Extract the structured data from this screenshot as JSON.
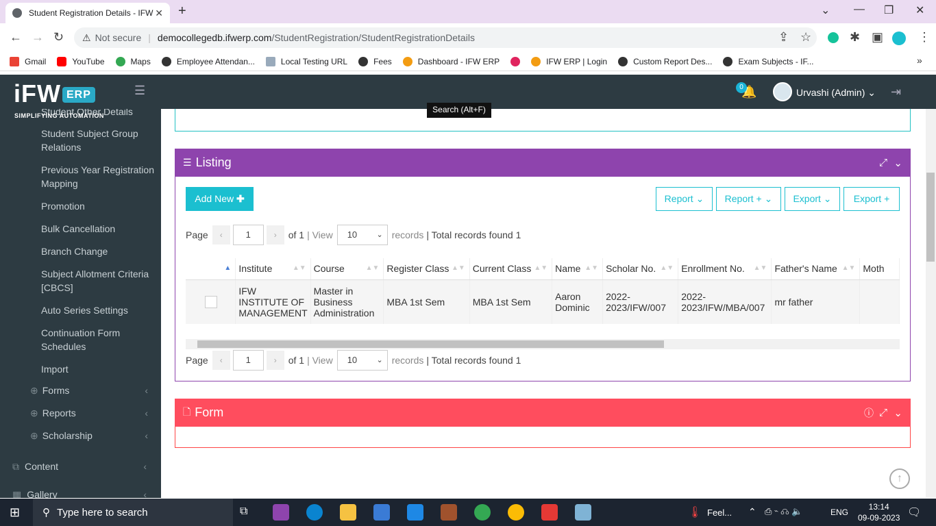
{
  "browser": {
    "tab_title": "Student Registration Details - IFW",
    "not_secure": "Not secure",
    "url_host": "democollegedb.ifwerp.com",
    "url_path": "/StudentRegistration/StudentRegistrationDetails",
    "bookmarks": [
      "Gmail",
      "YouTube",
      "Maps",
      "Employee Attendan...",
      "Local Testing URL",
      "Fees",
      "Dashboard - IFW ERP",
      "IFW ERP | Login",
      "Custom Report Des...",
      "Exam Subjects - IF..."
    ]
  },
  "header": {
    "logo_text": "iFW",
    "logo_badge": "ERP",
    "tagline": "SIMPLIFYING AUTOMATION",
    "notif_count": "0",
    "user": "Urvashi (Admin)"
  },
  "sidebar": {
    "items": [
      "Student Other Details",
      "Student Subject Group Relations",
      "Previous Year Registration Mapping",
      "Promotion",
      "Bulk Cancellation",
      "Branch Change",
      "Subject Allotment Criteria [CBCS]",
      "Auto Series Settings",
      "Continuation Form Schedules",
      "Import"
    ],
    "sections": [
      "Forms",
      "Reports",
      "Scholarship"
    ],
    "top": [
      "Content",
      "Gallery"
    ]
  },
  "tooltip": "Search (Alt+F)",
  "listing": {
    "title": "Listing",
    "add_new": "Add New",
    "buttons": [
      "Report",
      "Report +",
      "Export",
      "Export +"
    ],
    "page_label": "Page",
    "page_value": "1",
    "of_text": "of 1",
    "view_label": "| View",
    "view_value": "10",
    "records_label": "records",
    "total_text": "| Total records found 1",
    "columns": [
      "Institute",
      "Course",
      "Register Class",
      "Current Class",
      "Name",
      "Scholar No.",
      "Enrollment No.",
      "Father's Name",
      "Moth"
    ],
    "rows": [
      [
        "IFW INSTITUTE OF MANAGEMENT",
        "Master in Business Administration",
        "MBA 1st Sem",
        "MBA 1st Sem",
        "Aaron Dominic",
        "2022-2023/IFW/007",
        "2022-2023/IFW/MBA/007",
        "mr father",
        ""
      ]
    ]
  },
  "form": {
    "title": "Form"
  },
  "taskbar": {
    "search": "Type here to search",
    "weather": "Feel...",
    "lang": "ENG",
    "time": "13:14",
    "date": "09-09-2023"
  },
  "colors": {
    "listing": "#8e44ad",
    "form": "#ff4d5e",
    "accent": "#1bbfd0",
    "sidebar": "#2d3b42"
  }
}
